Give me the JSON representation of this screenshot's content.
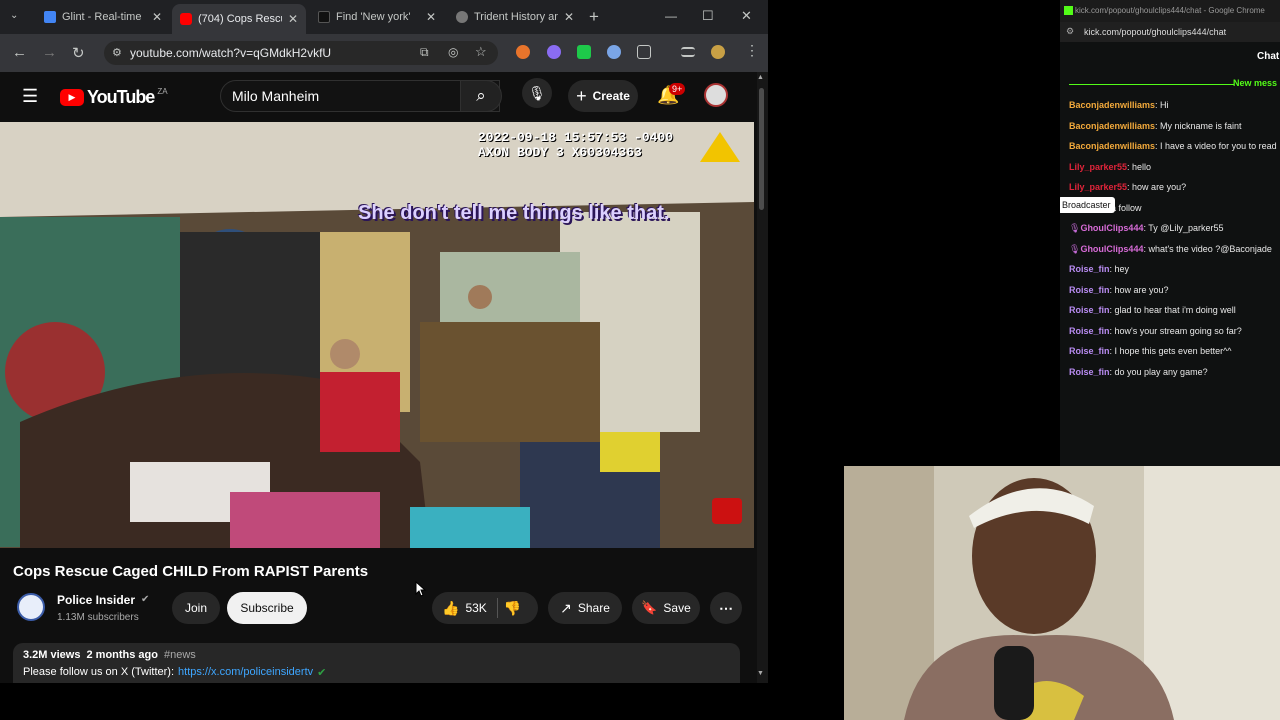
{
  "browser": {
    "tabs": [
      {
        "label": "Glint - Real-time",
        "color": "#4285f4"
      },
      {
        "label": "(704) Cops Rescu",
        "color": "#ff0000"
      },
      {
        "label": "Find 'New york'",
        "color": "#222222"
      },
      {
        "label": "Trident History an",
        "color": "#888888"
      }
    ],
    "new_tab": "+",
    "url": "youtube.com/watch?v=qGMdkH2vkfU",
    "window_controls": {
      "minimize": "—",
      "maximize": "☐",
      "close": "✕"
    }
  },
  "youtube": {
    "logo_text": "YouTube",
    "region": "ZA",
    "search_value": "Milo Manheim",
    "create_label": "Create",
    "notification_badge": "9+",
    "video": {
      "timestamp_line1": "2022-09-18 15:57:53 -0400",
      "timestamp_line2": "AXON BODY 3 X60304363",
      "caption": "She don't tell me things like that."
    },
    "title": "Cops Rescue Caged CHILD From RAPIST Parents",
    "channel": {
      "name": "Police Insider",
      "subscribers": "1.13M subscribers",
      "join_label": "Join",
      "subscribe_label": "Subscribe"
    },
    "actions": {
      "likes": "53K",
      "share_label": "Share",
      "save_label": "Save"
    },
    "description": {
      "views": "3.2M views",
      "age": "2 months ago",
      "hashtag": "#news",
      "follow_text": "Please follow us on X (Twitter):",
      "link": "https://x.com/policeinsidertv"
    }
  },
  "chat_window": {
    "window_title": "kick.com/popout/ghoulclips444/chat - Google Chrome",
    "url": "kick.com/popout/ghoulclips444/chat",
    "header": "Chat",
    "new_messages": "New mess",
    "tooltip": "Broadcaster",
    "messages": [
      {
        "user": "Baconjadenwilliams",
        "text": ": Hi",
        "color": "#f2a93b"
      },
      {
        "user": "Baconjadenwilliams",
        "text": ": My nickname is faint",
        "color": "#f2a93b"
      },
      {
        "user": "Baconjadenwilliams",
        "text": ": I have a video for you to read",
        "color": "#f2a93b"
      },
      {
        "user": "Lily_parker55",
        "text": ": hello",
        "color": "#e0243a"
      },
      {
        "user": "Lily_parker55",
        "text": ": how are you?",
        "color": "#e0243a"
      },
      {
        "user": "",
        "text": ": Dropped a follow",
        "color": "#d66bd6"
      },
      {
        "user": "GhoulClips444",
        "text": ": Ty @Lily_parker55",
        "color": "#d66bd6"
      },
      {
        "user": "GhoulClips444",
        "text": ": what's the video ?@Baconjade",
        "color": "#d66bd6"
      },
      {
        "user": "Roise_fin",
        "text": ": hey",
        "color": "#b98cf2"
      },
      {
        "user": "Roise_fin",
        "text": ": how are you?",
        "color": "#b98cf2"
      },
      {
        "user": "Roise_fin",
        "text": ": glad to hear that i'm doing well",
        "color": "#b98cf2"
      },
      {
        "user": "Roise_fin",
        "text": ": how's your stream going so far?",
        "color": "#b98cf2"
      },
      {
        "user": "Roise_fin",
        "text": ": I hope this gets even better^^",
        "color": "#b98cf2"
      },
      {
        "user": "Roise_fin",
        "text": ": do you play any game?",
        "color": "#b98cf2"
      }
    ]
  }
}
